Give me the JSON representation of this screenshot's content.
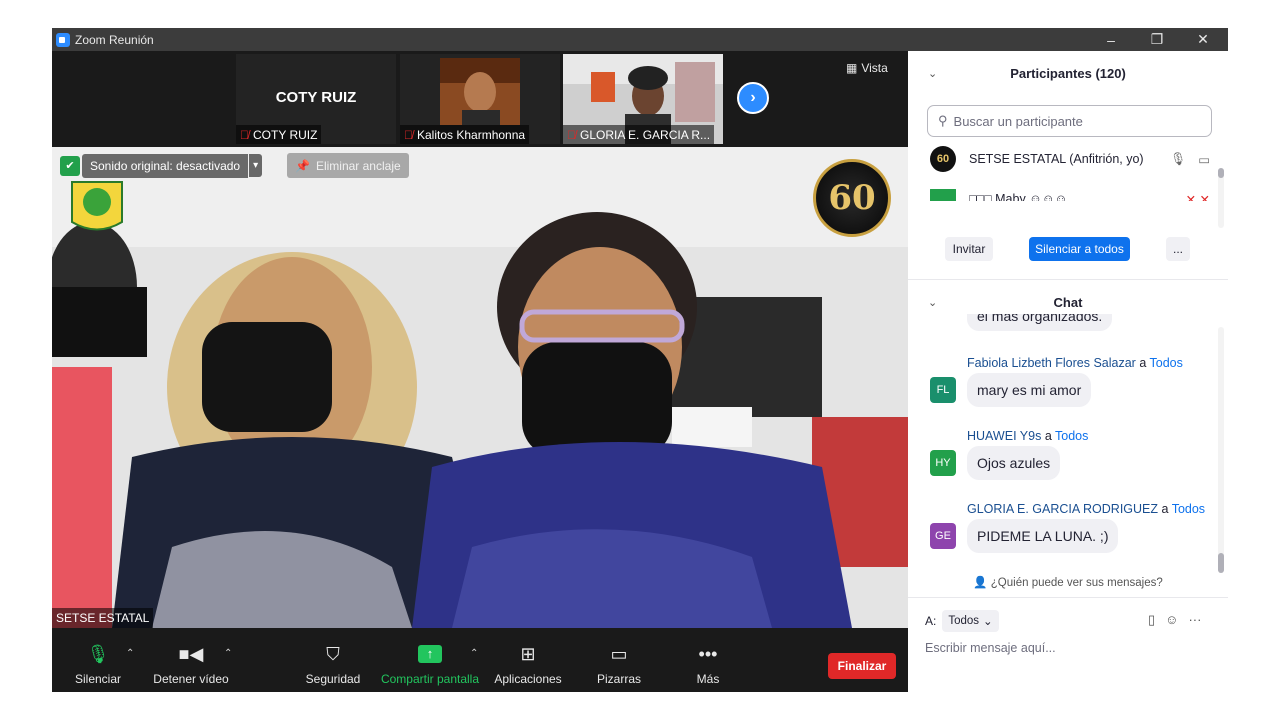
{
  "window": {
    "title": "Zoom Reunión",
    "controls": [
      "–",
      "❐",
      "✕"
    ]
  },
  "strip": {
    "thumbs": [
      {
        "label": "COTY RUIZ",
        "center_text": "COTY RUIZ"
      },
      {
        "label": "Kalitos Kharmhonna"
      },
      {
        "label": "GLORIA E. GARCIA R..."
      }
    ],
    "vista_label": "Vista"
  },
  "main_video": {
    "speaker_label": "SETSE ESTATAL",
    "sound_text": "Sonido original: desactivado",
    "unpin_text": "Eliminar anclaje",
    "badge_text": "60"
  },
  "toolbar": {
    "mute_label": "Silenciar",
    "video_label": "Detener vídeo",
    "security_label": "Seguridad",
    "share_label": "Compartir pantalla",
    "apps_label": "Aplicaciones",
    "whiteboard_label": "Pizarras",
    "more_label": "Más",
    "end_label": "Finalizar"
  },
  "participants": {
    "title": "Participantes (120)",
    "search_placeholder": "Buscar un participante",
    "host_row": "SETSE ESTATAL (Anfitrión, yo)",
    "host_avatar": "60",
    "second_row": "□□□ Maby ☺☺☺",
    "invite_label": "Invitar",
    "mute_all_label": "Silenciar a todos",
    "more_label": "..."
  },
  "chat": {
    "title": "Chat",
    "partial_text": "el más organizados.",
    "to_word": "a",
    "messages": [
      {
        "sender": "Fabiola Lizbeth Flores Salazar",
        "to": "Todos",
        "initials": "FL",
        "color": "#1a8f6c",
        "text": "mary es mi amor"
      },
      {
        "sender": "HUAWEI Y9s",
        "to": "Todos",
        "initials": "HY",
        "color": "#22a04b",
        "text": "Ojos azules"
      },
      {
        "sender": "GLORIA E. GARCIA RODRIGUEZ",
        "to": "Todos",
        "initials": "GE",
        "color": "#8e44ad",
        "text": "PIDEME LA LUNA. ;)"
      }
    ],
    "who_sees": "¿Quién puede ver sus mensajes?",
    "to_label": "A:",
    "to_value": "Todos",
    "input_placeholder": "Escribir mensaje aquí..."
  }
}
